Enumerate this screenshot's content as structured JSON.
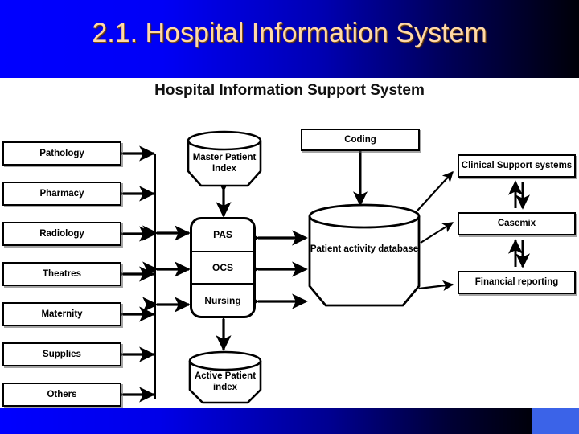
{
  "slide": {
    "title": "2.1. Hospital Information System",
    "title_color": "#ffd9a8",
    "header_color": "#0000ff",
    "footer_color": "#0000ff",
    "footer_badge_color": "#3b63e8"
  },
  "diagram": {
    "title": "Hospital Information Support System",
    "departments": [
      {
        "label": "Pathology"
      },
      {
        "label": "Pharmacy"
      },
      {
        "label": "Radiology"
      },
      {
        "label": "Theatres"
      },
      {
        "label": "Maternity"
      },
      {
        "label": "Supplies"
      },
      {
        "label": "Others"
      }
    ],
    "core_modules": [
      {
        "label": "PAS"
      },
      {
        "label": "OCS"
      },
      {
        "label": "Nursing"
      }
    ],
    "databases": [
      {
        "id": "master-patient-index",
        "label": "Master Patient Index"
      },
      {
        "id": "patient-activity-database",
        "label": "Patient activity database"
      },
      {
        "id": "active-patient-index",
        "label": "Active Patient index"
      }
    ],
    "coding_box": {
      "label": "Coding"
    },
    "right_systems": [
      {
        "label": "Clinical Support systems"
      },
      {
        "label": "Casemix"
      },
      {
        "label": "Financial reporting"
      }
    ]
  }
}
